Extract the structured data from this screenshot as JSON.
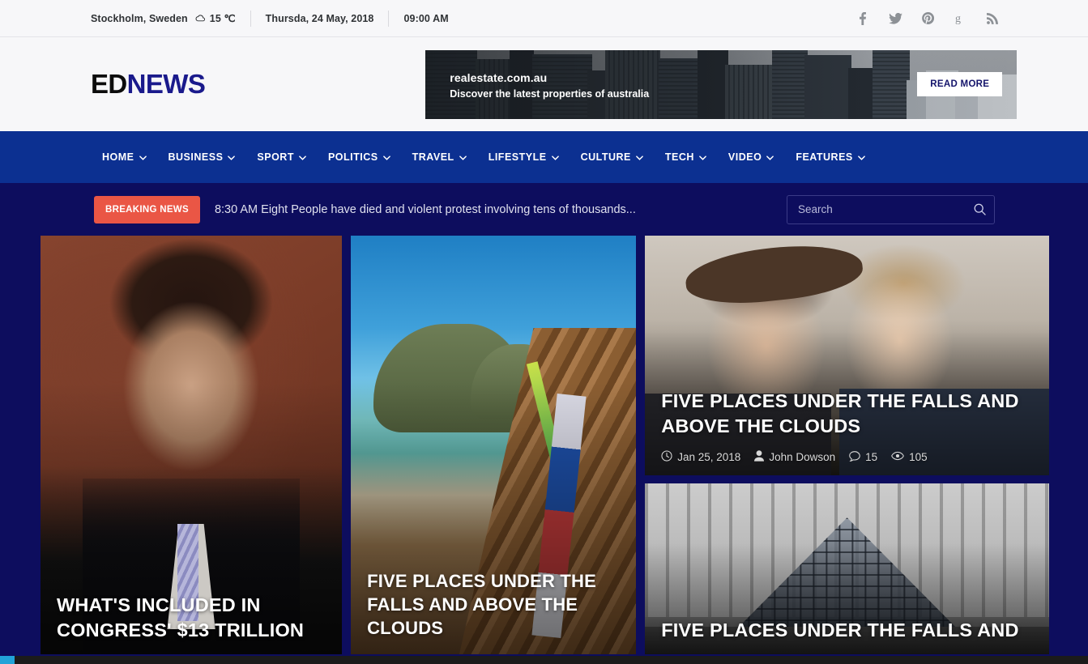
{
  "topbar": {
    "location": "Stockholm, Sweden",
    "temperature": "15 ℃",
    "weather_icon": "cloud-icon",
    "date": "Thursda, 24 May, 2018",
    "time": "09:00 AM",
    "social": [
      {
        "name": "facebook-icon",
        "label": "f"
      },
      {
        "name": "twitter-icon",
        "label": "t"
      },
      {
        "name": "pinterest-icon",
        "label": "p"
      },
      {
        "name": "google-plus-icon",
        "label": "g"
      },
      {
        "name": "rss-icon",
        "label": "rss"
      }
    ]
  },
  "header": {
    "logo_first": "ED",
    "logo_second": "NEWS",
    "ad": {
      "title": "realestate.com.au",
      "subtitle": "Discover the latest properties of australia",
      "button": "READ MORE"
    }
  },
  "nav": {
    "items": [
      {
        "label": "HOME"
      },
      {
        "label": "BUSINESS"
      },
      {
        "label": "SPORT"
      },
      {
        "label": "POLITICS"
      },
      {
        "label": "TRAVEL"
      },
      {
        "label": "LIFESTYLE"
      },
      {
        "label": "CULTURE"
      },
      {
        "label": "TECH"
      },
      {
        "label": "VIDEO"
      },
      {
        "label": "FEATURES"
      }
    ]
  },
  "breaking": {
    "badge": "BREAKING NEWS",
    "headline": "8:30 AM Eight People have died and violent protest involving tens of thousands...",
    "search_placeholder": "Search",
    "search_value": ""
  },
  "cards": {
    "left": {
      "title": "WHAT'S INCLUDED IN CONGRESS' $13 TRILLION",
      "image": "man-in-suit-at-podium"
    },
    "middle": {
      "title": "FIVE PLACES UNDER THE FALLS AND ABOVE THE CLOUDS",
      "image": "longtail-boat-tropical-island"
    },
    "right_top": {
      "title": "FIVE PLACES UNDER THE FALLS AND ABOVE THE CLOUDS",
      "image": "two-women-smiling-outdoors",
      "date": "Jan 25, 2018",
      "author": "John Dowson",
      "comments": "15",
      "views": "105"
    },
    "right_bottom": {
      "title": "FIVE PLACES UNDER THE FALLS AND",
      "image": "louvre-pyramid-paris"
    }
  },
  "colors": {
    "nav_blue": "#0c3091",
    "page_navy": "#0d0d5e",
    "breaking_red": "#ea5645",
    "logo_navy": "#1a1a8c",
    "topbar_bg": "#f7f7f9",
    "scrollbar_thumb": "#22a3d8"
  }
}
